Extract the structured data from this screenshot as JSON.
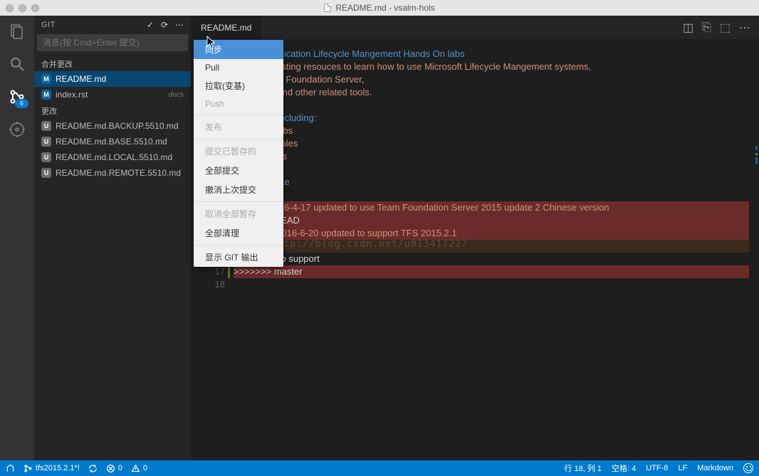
{
  "window": {
    "title": "README.md - vsalm-hols"
  },
  "activity": {
    "scm_badge": "6"
  },
  "git_panel": {
    "title": "GIT",
    "commit_placeholder": "消息(按 Cmd+Enter 提交)",
    "group_merge": "合并更改",
    "group_changes": "更改",
    "merge_files": [
      {
        "badge": "M",
        "name": "README.md"
      },
      {
        "badge": "M",
        "name": "index.rst",
        "meta": "docs"
      }
    ],
    "change_files": [
      {
        "badge": "U",
        "name": "README.md.BACKUP.5510.md"
      },
      {
        "badge": "U",
        "name": "README.md.BASE.5510.md"
      },
      {
        "badge": "U",
        "name": "README.md.LOCAL.5510.md"
      },
      {
        "badge": "U",
        "name": "README.md.REMOTE.5510.md"
      }
    ]
  },
  "tabs": {
    "active": "README.md"
  },
  "context_menu": {
    "items": [
      {
        "label": "同步",
        "selected": true
      },
      {
        "label": "Pull"
      },
      {
        "label": "拉取(变基)"
      },
      {
        "label": "Push",
        "disabled": true
      },
      {
        "sep": true
      },
      {
        "label": "发布",
        "disabled": true
      },
      {
        "sep": true
      },
      {
        "label": "提交已暂存的",
        "disabled": true
      },
      {
        "label": "全部提交"
      },
      {
        "label": "撤消上次提交"
      },
      {
        "sep": true
      },
      {
        "label": "取消全部暂存",
        "disabled": true
      },
      {
        "label": "全部清理"
      },
      {
        "sep": true
      },
      {
        "label": "显示 GIT 输出"
      }
    ]
  },
  "editor": {
    "lines_start": 14,
    "content": [
      {
        "n": "",
        "cls": "tok-h",
        "text": "icrosoft Application Lifecycle Mangement Hands On labs"
      },
      {
        "n": "",
        "cls": "tok-t",
        "text": "s repo is hosting resouces to learn how to use Microsoft Lifecycle Mangement systems,"
      },
      {
        "n": "",
        "cls": "tok-t",
        "text": "luding Team Foundation Server,"
      },
      {
        "n": "",
        "cls": "tok-t",
        "text": "ual Studio and other related tools."
      },
      {
        "n": "",
        "cls": "",
        "text": ""
      },
      {
        "n": "",
        "cls": "tok-h",
        "text": "Resouces including:"
      },
      {
        "n": "",
        "cls": "tok-t",
        "text": "Hands on labs"
      },
      {
        "n": "",
        "cls": "tok-t",
        "text": "Code examples"
      },
      {
        "n": "",
        "cls": "tok-t",
        "text": "Setup scripts"
      },
      {
        "n": "",
        "cls": "",
        "text": ""
      },
      {
        "n": "",
        "cls": "tok-h",
        "text": "Release Note"
      },
      {
        "n": "",
        "cls": "",
        "text": ""
      },
      {
        "n": "",
        "cls": "tok-t",
        "text": "015.2 @2016-4-17 updated to use Team Foundation Server 2015 update 2 Chinese version",
        "hl": "red"
      },
      {
        "n": "14",
        "cls": "tok-d",
        "text": "<<<<<<< HEAD",
        "hl": "red",
        "g": true
      },
      {
        "n": "15",
        "cls": "tok-t",
        "text": "015.2.1 @2016-6-20 updated to support TFS 2015.2.1",
        "hl": "red",
        "g": true
      },
      {
        "n": "15",
        "cls": "tok-d",
        "text": "=======",
        "hl": "dark",
        "g": true
      },
      {
        "n": "16",
        "cls": "tok-d",
        "text": "adding gitlab support",
        "g": true
      },
      {
        "n": "17",
        "cls": "tok-d",
        "text": ">>>>>>> master",
        "hl": "red",
        "g": true
      },
      {
        "n": "18",
        "cls": "",
        "text": ""
      }
    ]
  },
  "statusbar": {
    "branch": "tfs2015.2.1*!",
    "errors": "0",
    "warnings": "0",
    "line_col": "行 18, 列 1",
    "spaces": "空格: 4",
    "encoding": "UTF-8",
    "eol": "LF",
    "lang": "Markdown"
  },
  "watermark": "http://blog.csdn.net/u013417227"
}
